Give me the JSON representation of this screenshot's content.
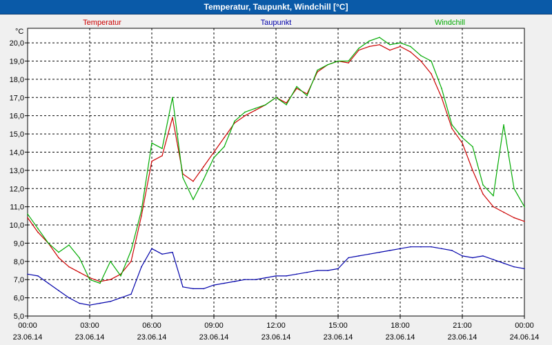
{
  "window": {
    "title": "Temperatur, Taupunkt, Windchill [°C]"
  },
  "chart_data": {
    "type": "line",
    "title": "Temperatur, Taupunkt, Windchill [°C]",
    "yunit": "°C",
    "xlim_hours": [
      0,
      24
    ],
    "ylim": [
      5.0,
      20.8
    ],
    "y_ticks": [
      "5,0",
      "6,0",
      "7,0",
      "8,0",
      "9,0",
      "10,0",
      "11,0",
      "12,0",
      "13,0",
      "14,0",
      "15,0",
      "16,0",
      "17,0",
      "18,0",
      "19,0",
      "20,0"
    ],
    "x_ticks": [
      {
        "time": "00:00",
        "date": "23.06.14"
      },
      {
        "time": "03:00",
        "date": "23.06.14"
      },
      {
        "time": "06:00",
        "date": "23.06.14"
      },
      {
        "time": "09:00",
        "date": "23.06.14"
      },
      {
        "time": "12:00",
        "date": "23.06.14"
      },
      {
        "time": "15:00",
        "date": "23.06.14"
      },
      {
        "time": "18:00",
        "date": "23.06.14"
      },
      {
        "time": "21:00",
        "date": "23.06.14"
      },
      {
        "time": "00:00",
        "date": "24.06.14"
      }
    ],
    "grid": true,
    "series": [
      {
        "name": "Temperatur",
        "color": "#cc0000",
        "x": [
          0,
          0.5,
          1,
          1.5,
          2,
          2.5,
          3,
          3.5,
          4,
          4.5,
          5,
          5.5,
          6,
          6.5,
          7,
          7.5,
          8,
          8.5,
          9,
          9.5,
          10,
          10.5,
          11,
          11.5,
          12,
          12.5,
          13,
          13.5,
          14,
          14.5,
          15,
          15.5,
          16,
          16.5,
          17,
          17.5,
          18,
          18.5,
          19,
          19.5,
          20,
          20.5,
          21,
          21.5,
          22,
          22.5,
          23,
          23.5,
          24
        ],
        "y": [
          10.4,
          9.6,
          9.0,
          8.2,
          7.7,
          7.4,
          7.1,
          6.9,
          7.0,
          7.3,
          8.0,
          10.5,
          13.5,
          13.8,
          15.9,
          12.8,
          12.4,
          13.2,
          14.0,
          14.8,
          15.6,
          16.0,
          16.3,
          16.6,
          17.0,
          16.7,
          17.5,
          17.2,
          18.4,
          18.8,
          19.0,
          18.9,
          19.6,
          19.8,
          19.9,
          19.6,
          19.8,
          19.5,
          19.0,
          18.3,
          17.0,
          15.3,
          14.5,
          13.0,
          11.7,
          11.0,
          10.7,
          10.4,
          10.2
        ]
      },
      {
        "name": "Taupunkt",
        "color": "#0000aa",
        "x": [
          0,
          0.5,
          1,
          1.5,
          2,
          2.5,
          3,
          3.5,
          4,
          4.5,
          5,
          5.5,
          6,
          6.5,
          7,
          7.5,
          8,
          8.5,
          9,
          9.5,
          10,
          10.5,
          11,
          11.5,
          12,
          12.5,
          13,
          13.5,
          14,
          14.5,
          15,
          15.5,
          16,
          16.5,
          17,
          17.5,
          18,
          18.5,
          19,
          19.5,
          20,
          20.5,
          21,
          21.5,
          22,
          22.5,
          23,
          23.5,
          24
        ],
        "y": [
          7.3,
          7.2,
          6.8,
          6.4,
          6.0,
          5.7,
          5.6,
          5.7,
          5.8,
          6.0,
          6.2,
          7.7,
          8.7,
          8.4,
          8.5,
          6.6,
          6.5,
          6.5,
          6.7,
          6.8,
          6.9,
          7.0,
          7.0,
          7.1,
          7.2,
          7.2,
          7.3,
          7.4,
          7.5,
          7.5,
          7.6,
          8.2,
          8.3,
          8.4,
          8.5,
          8.6,
          8.7,
          8.8,
          8.8,
          8.8,
          8.7,
          8.6,
          8.3,
          8.2,
          8.3,
          8.1,
          7.9,
          7.7,
          7.6
        ]
      },
      {
        "name": "Windchill",
        "color": "#00aa00",
        "x": [
          0,
          0.5,
          1,
          1.5,
          2,
          2.5,
          3,
          3.5,
          4,
          4.5,
          5,
          5.5,
          6,
          6.5,
          7,
          7.5,
          8,
          8.5,
          9,
          9.5,
          10,
          10.5,
          11,
          11.5,
          12,
          12.5,
          13,
          13.5,
          14,
          14.5,
          15,
          15.5,
          16,
          16.5,
          17,
          17.5,
          18,
          18.5,
          19,
          19.5,
          20,
          20.5,
          21,
          21.5,
          22,
          22.5,
          23,
          23.5,
          24
        ],
        "y": [
          10.6,
          9.8,
          9.0,
          8.5,
          8.9,
          8.2,
          7.0,
          6.8,
          8.0,
          7.2,
          8.6,
          10.8,
          14.5,
          14.2,
          17.0,
          12.6,
          11.4,
          12.5,
          13.7,
          14.3,
          15.7,
          16.2,
          16.4,
          16.6,
          17.0,
          16.6,
          17.6,
          17.1,
          18.5,
          18.8,
          19.0,
          19.0,
          19.7,
          20.1,
          20.3,
          19.9,
          20.0,
          19.8,
          19.3,
          19.0,
          17.5,
          15.5,
          14.8,
          14.3,
          12.2,
          11.6,
          15.5,
          12.0,
          11.0
        ]
      }
    ]
  }
}
